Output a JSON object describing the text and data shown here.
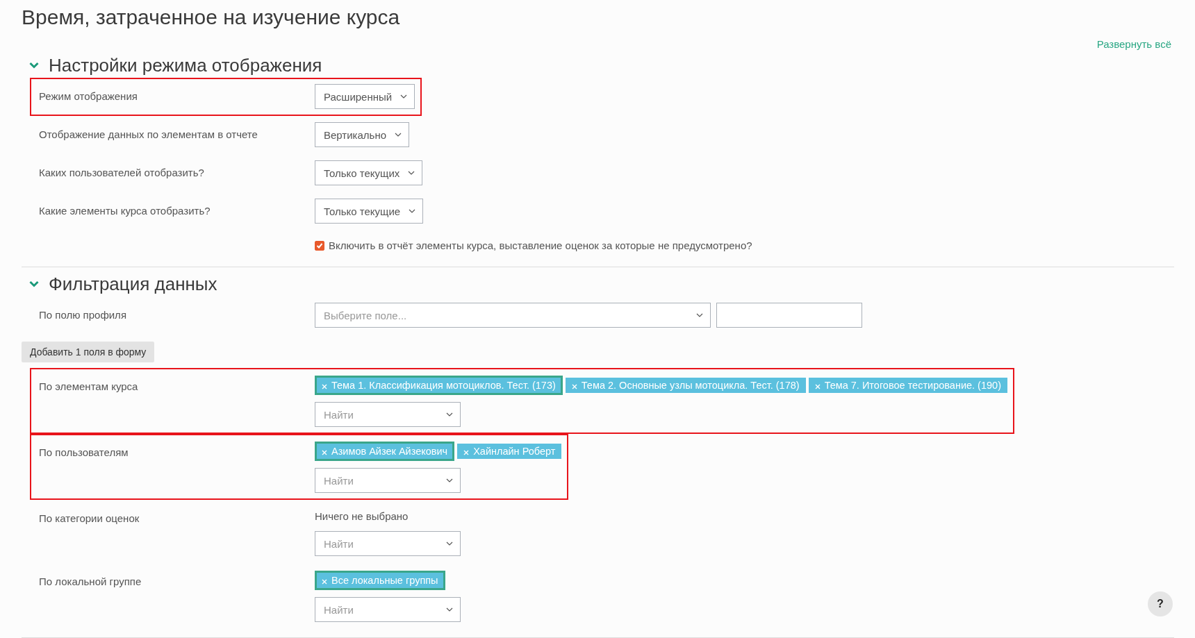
{
  "page": {
    "title": "Время, затраченное на изучение курса",
    "expand_all": "Развернуть всё"
  },
  "sections": [
    {
      "title": "Настройки режима отображения",
      "expanded": true,
      "rows": [
        {
          "kind": "select",
          "label": "Режим отображения",
          "value": "Расширенный",
          "highlighted": true
        },
        {
          "kind": "select",
          "label": "Отображение данных по элементам в отчете",
          "value": "Вертикально",
          "highlighted": false
        },
        {
          "kind": "select",
          "label": "Каких пользователей отобразить?",
          "value": "Только текущих",
          "highlighted": false
        },
        {
          "kind": "select",
          "label": "Какие элементы курса отобразить?",
          "value": "Только текущие",
          "highlighted": false
        },
        {
          "kind": "checkbox",
          "label": "Включить в отчёт элементы курса, выставление оценок за которые не предусмотрено?",
          "checked": true,
          "highlighted": false
        }
      ]
    },
    {
      "title": "Фильтрация данных",
      "expanded": true,
      "rows": [
        {
          "kind": "profile",
          "label": "По полю профиля",
          "placeholder": "Выберите поле...",
          "highlighted": false
        },
        {
          "kind": "button",
          "label": "Добавить 1 поля в форму"
        },
        {
          "kind": "tags",
          "label": "По элементам курса",
          "highlighted": true,
          "placeholder": "Найти",
          "tags": [
            {
              "text": "Тема 1. Классификация мотоциклов. Тест. (173)",
              "focused": true
            },
            {
              "text": "Тема 2. Основные узлы мотоцикла. Тест. (178)",
              "focused": false
            },
            {
              "text": "Тема 7. Итоговое тестирование. (190)",
              "focused": false
            }
          ]
        },
        {
          "kind": "tags",
          "label": "По пользователям",
          "highlighted": true,
          "placeholder": "Найти",
          "tags": [
            {
              "text": "Азимов Айзек Айзекович",
              "focused": true
            },
            {
              "text": "Хайнлайн Роберт",
              "focused": false
            }
          ]
        },
        {
          "kind": "tags",
          "label": "По категории оценок",
          "highlighted": false,
          "placeholder": "Найти",
          "empty_text": "Ничего не выбрано"
        },
        {
          "kind": "tags",
          "label": "По локальной группе",
          "highlighted": false,
          "placeholder": "Найти",
          "tags": [
            {
              "text": "Все локальные группы",
              "focused": true
            }
          ]
        }
      ]
    }
  ],
  "help_button": "?"
}
